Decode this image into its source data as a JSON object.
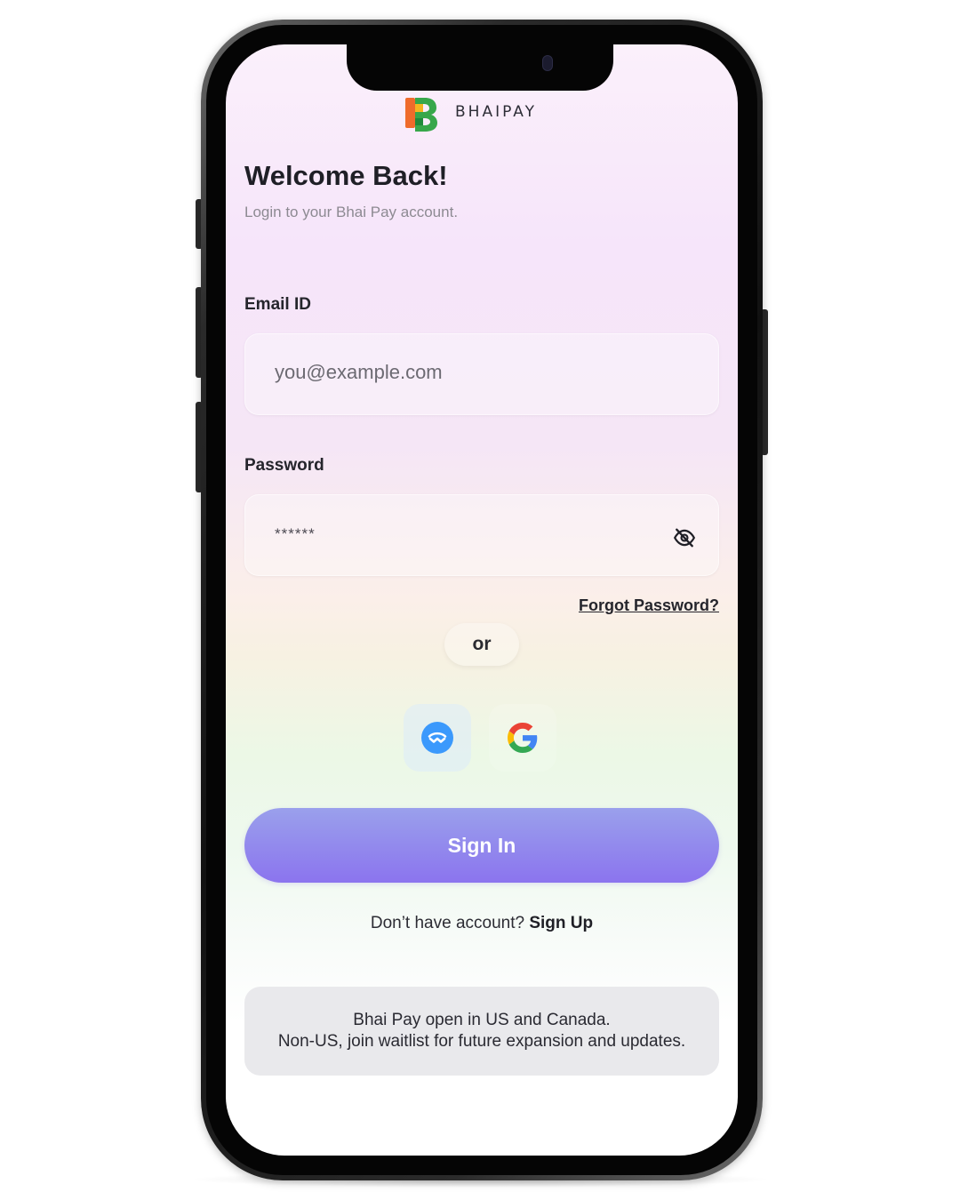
{
  "brand": {
    "name": "BHAIPAY"
  },
  "header": {
    "title": "Welcome Back!",
    "subtitle": "Login to your Bhai Pay account."
  },
  "email": {
    "label": "Email ID",
    "placeholder": "you@example.com",
    "value": ""
  },
  "password": {
    "label": "Password",
    "masked_value": "******",
    "toggle_icon": "eye-off-icon"
  },
  "links": {
    "forgot_password": "Forgot Password?"
  },
  "divider": {
    "text": "or"
  },
  "social": [
    {
      "name": "wallet-connect",
      "icon": "wallet-icon",
      "color": "#3b99fc"
    },
    {
      "name": "google",
      "icon": "google-icon"
    }
  ],
  "actions": {
    "sign_in": "Sign In"
  },
  "signup": {
    "prompt": "Don’t have account?",
    "link": "Sign Up"
  },
  "notice": {
    "line1": "Bhai Pay open in US and Canada.",
    "line2": "Non-US, join waitlist for future expansion and updates."
  },
  "colors": {
    "primary_button_top": "#9aa0ec",
    "primary_button_bottom": "#8b74ee",
    "text_dark": "#1f1f26",
    "text_muted": "#8d8a92"
  }
}
